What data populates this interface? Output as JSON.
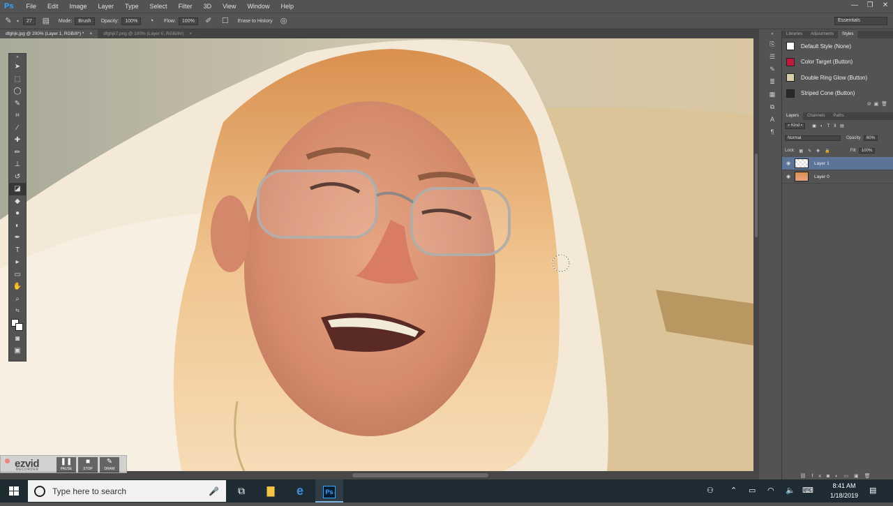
{
  "app": {
    "logo": "Ps",
    "menus": [
      "File",
      "Edit",
      "Image",
      "Layer",
      "Type",
      "Select",
      "Filter",
      "3D",
      "View",
      "Window",
      "Help"
    ],
    "window_controls": [
      "—",
      "❐",
      "✕"
    ]
  },
  "options_bar": {
    "brush_size": "27",
    "mode_label": "Mode:",
    "mode_value": "Brush",
    "opacity_label": "Opacity:",
    "opacity_value": "100%",
    "flow_label": "Flow:",
    "flow_value": "100%",
    "erase_to_history": "Erase to History",
    "workspace": "Essentials"
  },
  "doc_tabs": [
    {
      "label": "dfghjk.jpg @ 200% (Layer 1, RGB/8*) *",
      "active": true
    },
    {
      "label": "dfghjk7.png @ 100% (Layer 0, RGB/8#)",
      "active": false
    }
  ],
  "panels": {
    "top_tabs": [
      "Libraries",
      "Adjustments",
      "Styles"
    ],
    "styles": [
      {
        "label": "Default Style (None)",
        "color": "#ffffff"
      },
      {
        "label": "Color Target (Button)",
        "color": "#c0183a"
      },
      {
        "label": "Double Ring Glow (Button)",
        "color": "#d8cfa8"
      },
      {
        "label": "Striped Cone (Button)",
        "color": "#2a2a2a"
      }
    ],
    "layer_tabs": [
      "Layers",
      "Channels",
      "Paths"
    ],
    "kind_filter": "Kind",
    "blend_mode": "Normal",
    "opacity_label": "Opacity:",
    "opacity_value": "60%",
    "lock_label": "Lock:",
    "fill_label": "Fill:",
    "fill_value": "100%",
    "layers": [
      {
        "name": "Layer 1",
        "selected": true
      },
      {
        "name": "Layer 0",
        "selected": false
      }
    ]
  },
  "ezvid": {
    "brand": "ezvid",
    "sub": "RECORDER",
    "buttons": [
      "PAUSE",
      "STOP",
      "DRAW"
    ]
  },
  "taskbar": {
    "search_placeholder": "Type here to search",
    "time": "8:41 AM",
    "date": "1/18/2019"
  }
}
